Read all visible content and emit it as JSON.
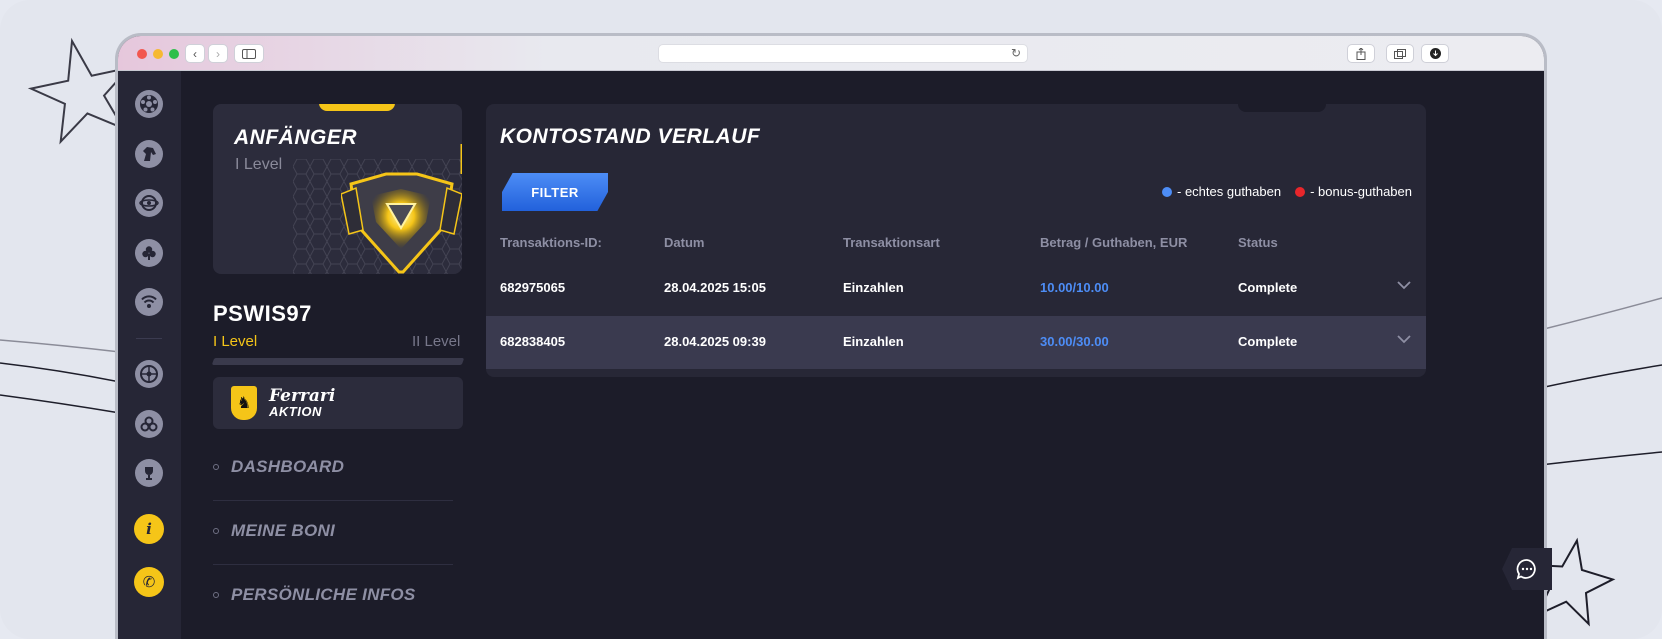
{
  "browser": {
    "nav_back": "‹",
    "nav_forward": "›"
  },
  "sidebar_rail": {
    "icons": [
      "soccer-icon",
      "horse-icon",
      "esports-icon",
      "casino-icon",
      "live-icon",
      "roulette-icon",
      "slots-icon",
      "trophy-icon",
      "info-icon",
      "support-phone-icon"
    ],
    "info_glyph": "i",
    "phone_glyph": "✆"
  },
  "profile": {
    "level_title": "ANFÄNGER",
    "level_subtitle": "I Level",
    "username": "PSWIS97",
    "current_level": "I Level",
    "next_level": "II Level",
    "progress": 0.0
  },
  "promo": {
    "brand": "Ferrari",
    "label": "AKTION",
    "shield_glyph": "♞"
  },
  "menu": [
    {
      "label": "DASHBOARD"
    },
    {
      "label": "MEINE BONI"
    },
    {
      "label": "PERSÖNLICHE INFOS"
    }
  ],
  "panel": {
    "title": "KONTOSTAND VERLAUF",
    "filter_label": "FILTER",
    "legend": [
      {
        "label": "- echtes guthaben",
        "color": "#4d8df6"
      },
      {
        "label": "- bonus-guthaben",
        "color": "#e8262b"
      }
    ],
    "columns": [
      "Transaktions-ID:",
      "Datum",
      "Transaktionsart",
      "Betrag / Guthaben, EUR",
      "Status"
    ],
    "rows": [
      {
        "id": "682975065",
        "date": "28.04.2025 15:05",
        "type": "Einzahlen",
        "amount": "10.00/10.00",
        "status": "Complete"
      },
      {
        "id": "682838405",
        "date": "28.04.2025 09:39",
        "type": "Einzahlen",
        "amount": "30.00/30.00",
        "status": "Complete"
      }
    ]
  },
  "colors": {
    "accent": "#f5c518",
    "primary_blue": "#4d8df6",
    "background": "#1c1c29"
  }
}
